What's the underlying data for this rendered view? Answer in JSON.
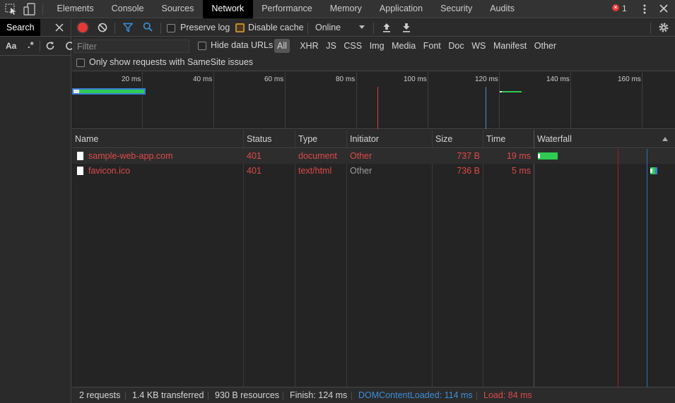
{
  "tabs": [
    "Elements",
    "Console",
    "Sources",
    "Network",
    "Performance",
    "Memory",
    "Application",
    "Security",
    "Audits"
  ],
  "active_tab": "Network",
  "error_count": "1",
  "search_panel": {
    "title": "Search",
    "case_label": "Aa",
    "regex_label": ".*"
  },
  "toolbar": {
    "preserve_log": "Preserve log",
    "disable_cache": "Disable cache",
    "throttling": "Online"
  },
  "filter": {
    "placeholder": "Filter",
    "hide_data_urls": "Hide data URLs",
    "types": [
      "All",
      "XHR",
      "JS",
      "CSS",
      "Img",
      "Media",
      "Font",
      "Doc",
      "WS",
      "Manifest",
      "Other"
    ],
    "samesite": "Only show requests with SameSite issues"
  },
  "overview": {
    "ticks": [
      "20 ms",
      "40 ms",
      "60 ms",
      "80 ms",
      "100 ms",
      "120 ms",
      "140 ms",
      "160 ms"
    ]
  },
  "table": {
    "headers": {
      "name": "Name",
      "status": "Status",
      "type": "Type",
      "initiator": "Initiator",
      "size": "Size",
      "time": "Time",
      "waterfall": "Waterfall"
    },
    "rows": [
      {
        "name": "sample-web-app.com",
        "status": "401",
        "type": "document",
        "initiator": "Other",
        "size": "737 B",
        "time": "19 ms"
      },
      {
        "name": "favicon.ico",
        "status": "401",
        "type": "text/html",
        "initiator": "Other",
        "size": "736 B",
        "time": "5 ms"
      }
    ]
  },
  "status_bar": {
    "requests": "2 requests",
    "transferred": "1.4 KB transferred",
    "resources": "930 B resources",
    "finish": "Finish: 124 ms",
    "dcl": "DOMContentLoaded: 114 ms",
    "load": "Load: 84 ms"
  },
  "colors": {
    "record": "#e53935",
    "error_text": "#e04848",
    "dcl": "#3d8ed8",
    "load": "#e53935",
    "bar_green": "#2ecc52",
    "bar_blue": "#3a7bd5"
  }
}
